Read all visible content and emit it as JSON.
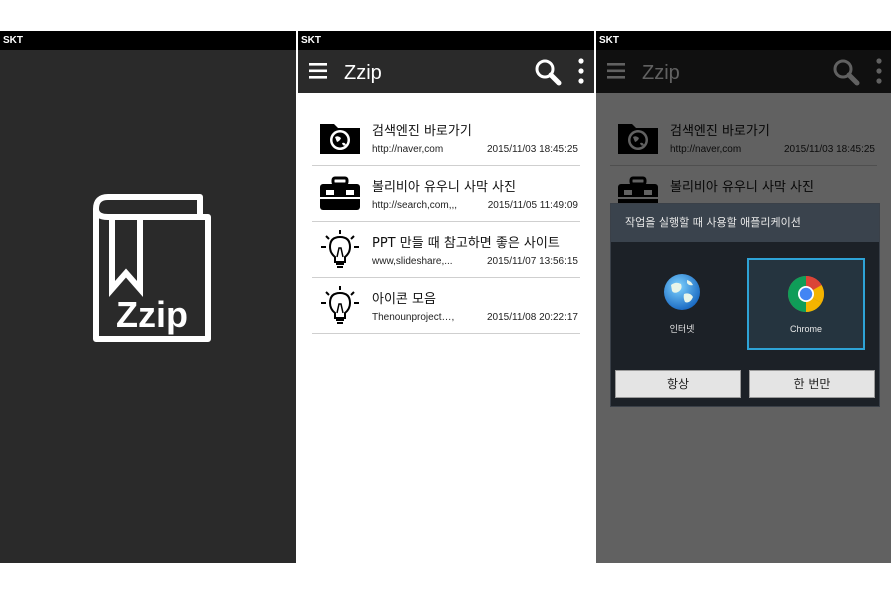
{
  "carrier": "SKT",
  "splash": {
    "logo_text": "Zzip"
  },
  "app": {
    "title": "Zzip",
    "icons": {
      "menu": "hamburger-menu-icon",
      "search": "search-icon",
      "more": "more-vertical-icon"
    }
  },
  "bookmarks": [
    {
      "title": "검색엔진 바로가기",
      "url": "http://naver,com",
      "date": "2015/11/03 18:45:25",
      "icon": "folder-globe-icon"
    },
    {
      "title": "볼리비아 유우니 사막 사진",
      "url": "http://search,com,,,",
      "date": "2015/11/05 11:49:09",
      "icon": "briefcase-icon"
    },
    {
      "title": "PPT 만들 때 참고하면 좋은 사이트",
      "url": "www,slideshare,...",
      "date": "2015/11/07 13:56:15",
      "icon": "lightbulb-icon"
    },
    {
      "title": "아이콘 모음",
      "url": "Thenounproject…,",
      "date": "2015/11/08 20:22:17",
      "icon": "lightbulb-icon"
    }
  ],
  "chooser": {
    "title": "작업을 실행할 때 사용할 애플리케이션",
    "options": [
      {
        "label": "인터넷",
        "icon": "internet-globe-icon"
      },
      {
        "label": "Chrome",
        "icon": "chrome-icon",
        "selected": true
      }
    ],
    "always_label": "항상",
    "once_label": "한 번만"
  },
  "colors": {
    "bar": "#2a2a2a",
    "dialog_bg": "#1c2127",
    "dialog_title": "#3a434d",
    "selection": "#2ea3d6"
  }
}
